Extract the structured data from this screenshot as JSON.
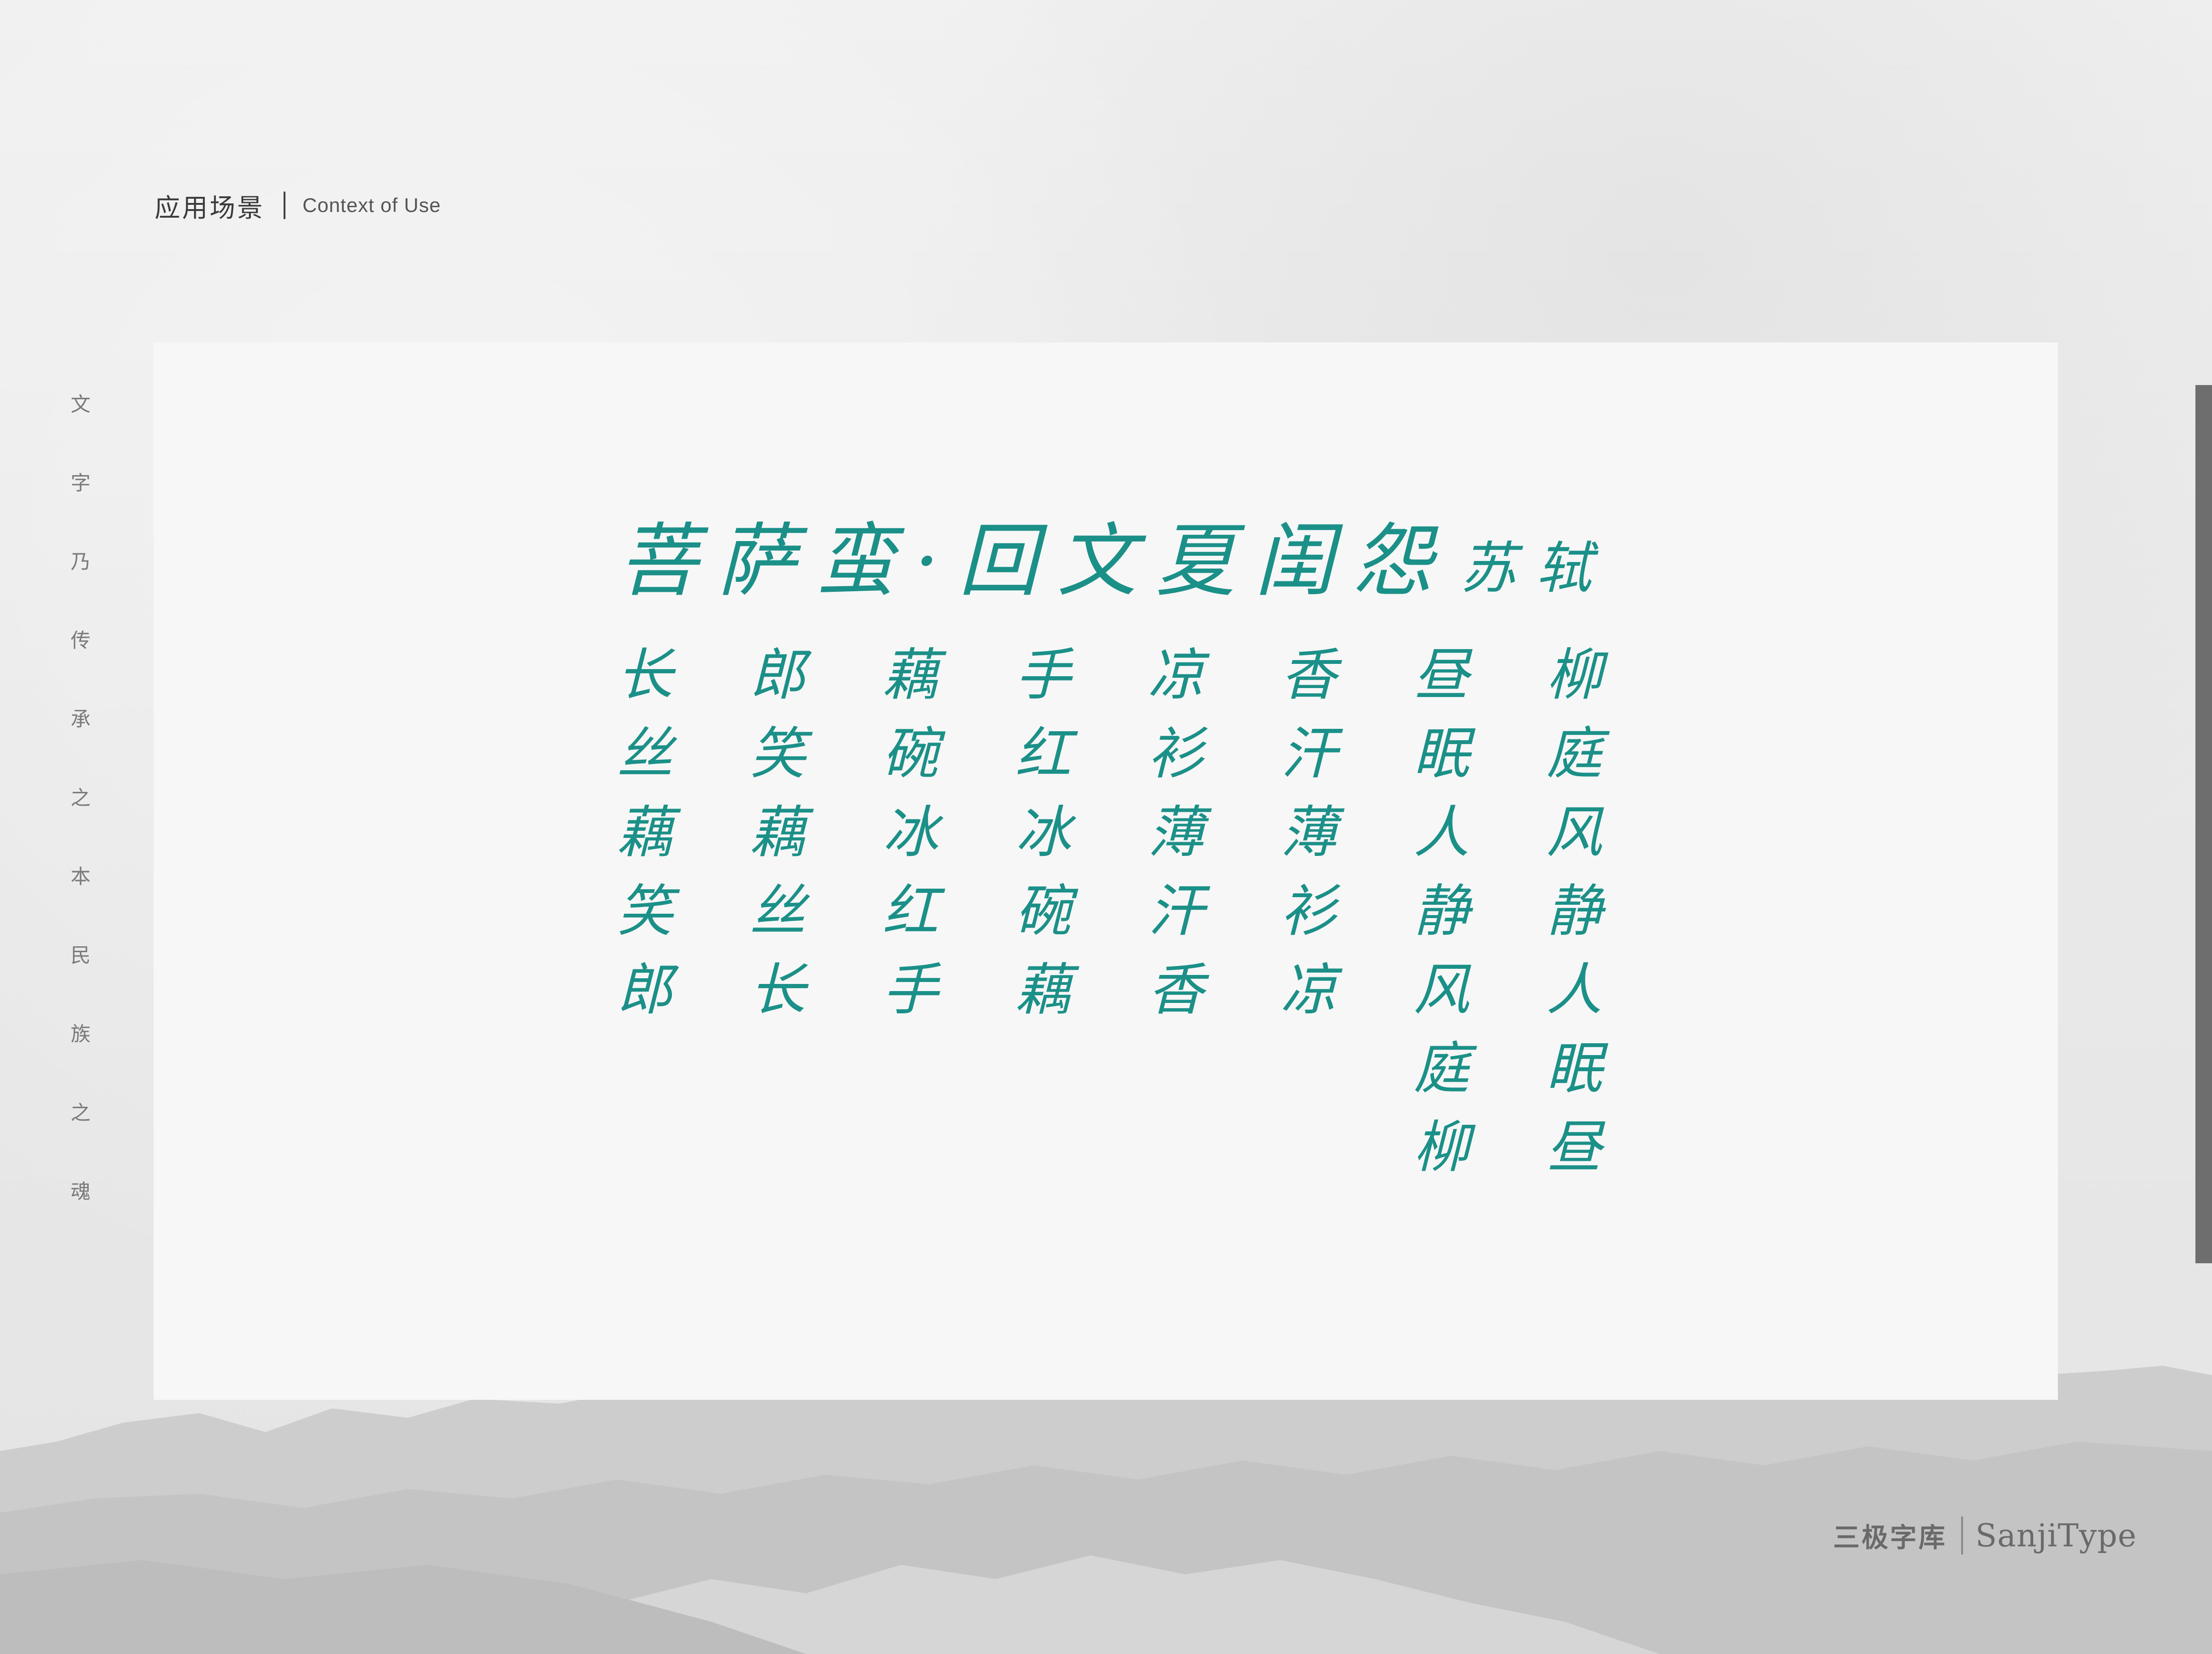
{
  "header": {
    "title_cn": "应用场景",
    "title_en": "Context of Use"
  },
  "side_text": [
    "文",
    "字",
    "乃",
    "传",
    "承",
    "之",
    "本",
    "民",
    "族",
    "之",
    "魂"
  ],
  "poem": {
    "title": "菩萨蛮·回文夏闺怨",
    "author": "苏轼",
    "columns": [
      [
        "柳",
        "庭",
        "风",
        "静",
        "人",
        "眠",
        "昼"
      ],
      [
        "昼",
        "眠",
        "人",
        "静",
        "风",
        "庭",
        "柳"
      ],
      [
        "香",
        "汗",
        "薄",
        "衫",
        "凉"
      ],
      [
        "凉",
        "衫",
        "薄",
        "汗",
        "香"
      ],
      [
        "手",
        "红",
        "冰",
        "碗",
        "藕"
      ],
      [
        "藕",
        "碗",
        "冰",
        "红",
        "手"
      ],
      [
        "郎",
        "笑",
        "藕",
        "丝",
        "长"
      ],
      [
        "长",
        "丝",
        "藕",
        "笑",
        "郎"
      ]
    ]
  },
  "brand": {
    "cn": "三极字库",
    "en": "SanjiType"
  },
  "colors": {
    "ink_green": "#1b9088",
    "card": "#f7f7f7",
    "background": "#ececec",
    "scroll_indicator": "#6e6e6e"
  }
}
